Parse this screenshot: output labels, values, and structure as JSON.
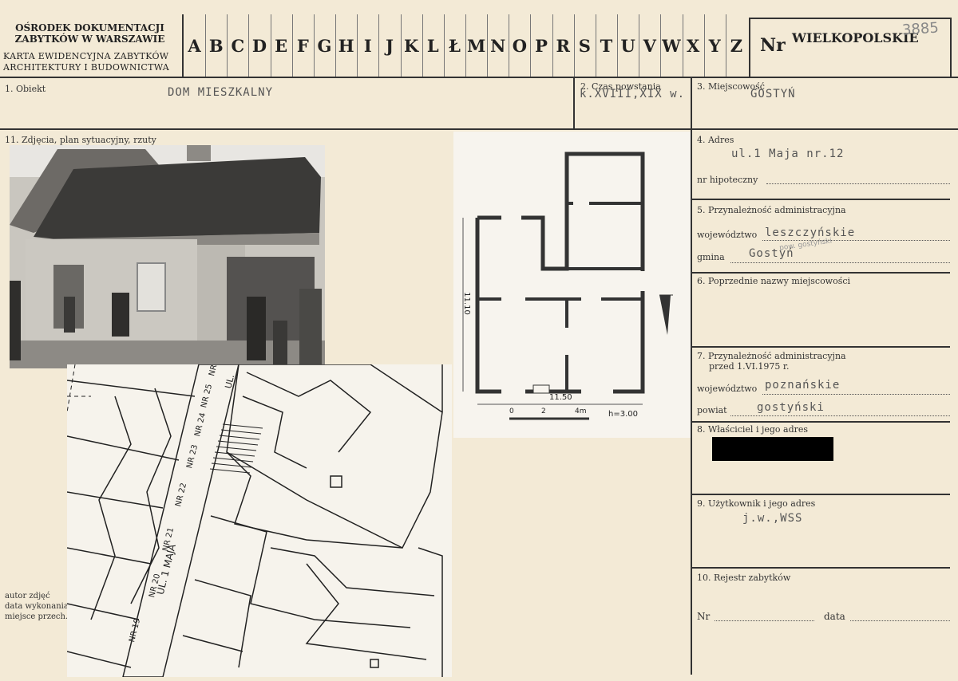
{
  "header": {
    "org_line1": "OŚRODEK DOKUMENTACJI",
    "org_line2": "ZABYTKÓW W WARSZAWIE",
    "card_line1": "KARTA EWIDENCYJNA ZABYTKÓW",
    "card_line2": "ARCHITEKTURY I BUDOWNICTWA",
    "letters": [
      "A",
      "B",
      "C",
      "D",
      "E",
      "F",
      "G",
      "H",
      "I",
      "J",
      "K",
      "L",
      "Ł",
      "M",
      "N",
      "O",
      "P",
      "R",
      "S",
      "T",
      "U",
      "V",
      "W",
      "X",
      "Y",
      "Z"
    ],
    "nr_label": "Nr",
    "region": "WIELKOPOLSKIE",
    "handwritten_number": "3885"
  },
  "fields": {
    "obiekt_label": "1. Obiekt",
    "obiekt_value": "DOM MIESZKALNY",
    "czas_label": "2. Czas powstania",
    "czas_value": "k.XVIII,XIX w.",
    "miejscowosc_label": "3. Miejscowość",
    "miejscowosc_value": "GOSTYŃ",
    "zdjecia_label": "11. Zdjęcia, plan sytuacyjny, rzuty",
    "adres_label": "4. Adres",
    "adres_value": "ul.1 Maja nr.12",
    "hipoteczny_label": "nr hipoteczny",
    "przynaleznosc_label": "5. Przynależność administracyjna",
    "wojewodztwo_label": "województwo",
    "wojewodztwo_value": "leszczyńskie",
    "wojewodztwo_annotation": "pow. gostyński",
    "gmina_label": "gmina",
    "gmina_value": "Gostyń",
    "poprzednie_label": "6. Poprzednie nazwy miejscowości",
    "przynaleznosc_przed_label1": "7. Przynależność administracyjna",
    "przynaleznosc_przed_label2": "przed 1.VI.1975 r.",
    "wojewodztwo2_label": "województwo",
    "wojewodztwo2_value": "poznańskie",
    "powiat_label": "powiat",
    "powiat_value": "gostyński",
    "wlasciciel_label": "8. Właściciel i jego adres",
    "uzytkownik_label": "9. Użytkownik i jego adres",
    "uzytkownik_value": "j.w.,WSS",
    "rejestr_label": "10. Rejestr zabytków",
    "nr_label": "Nr",
    "data_label": "data",
    "autor_label": "autor zdjęć",
    "data_wykonania_label": "data wykonania",
    "miejsce_label": "miejsce przech."
  },
  "plan": {
    "dim_height": "11.10",
    "dim_width": "11.50",
    "scale_0": "0",
    "scale_2": "2",
    "scale_4": "4m",
    "height_note": "h=3.00"
  },
  "map": {
    "street_name": "UL. 1 MAJA",
    "street_label_top": "UL.",
    "numbers": [
      "NR 19",
      "NR 20",
      "NR 21",
      "NR 22",
      "NR 23",
      "NR 24",
      "NR 25",
      "NR"
    ]
  }
}
